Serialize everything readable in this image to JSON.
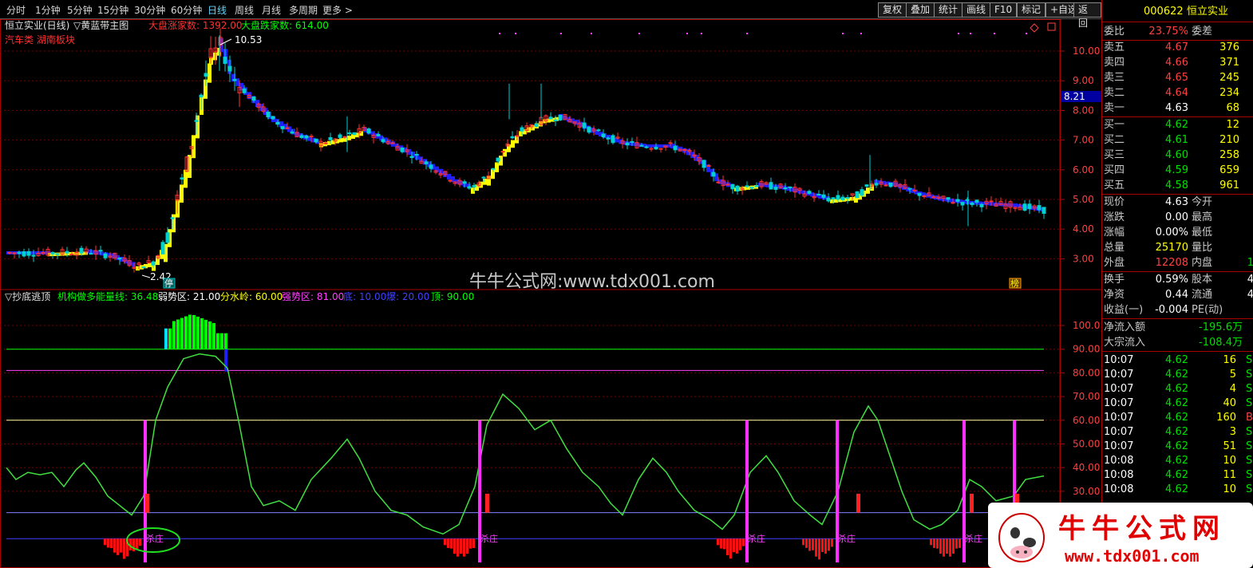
{
  "toolbar": {
    "periods": [
      "分时",
      "1分钟",
      "5分钟",
      "15分钟",
      "30分钟",
      "60分钟",
      "日线",
      "周线",
      "月线",
      "多周期",
      "更多 >"
    ],
    "active_period": "日线",
    "buttons": [
      "复权",
      "叠加",
      "统计",
      "画线",
      "F10",
      "标记",
      "+自选",
      "返回"
    ]
  },
  "main_chart": {
    "title": "恒立实业(日线)",
    "indicator": "▽黄蓝带主图",
    "up_count_label": "大盘涨家数: 1392.00",
    "down_count_label": "大盘跌家数: 614.00",
    "sector_tags": "汽车类 湖南板块",
    "high_label": "10.53",
    "low_label": "2.42",
    "current_price_tag": "8.21",
    "y_ticks": [
      "10.00",
      "9.00",
      "8.00",
      "7.00",
      "6.00",
      "5.00",
      "4.00",
      "3.00"
    ],
    "watermark": "牛牛公式网:www.tdx001.com",
    "mark_left": "停",
    "mark_right": "榜"
  },
  "sub_chart": {
    "title": "▽抄底逃顶",
    "legend": [
      {
        "text": "机构做多能量线: 36.48",
        "color": "#00ff00"
      },
      {
        "text": "弱势区: 21.00",
        "color": "#ffffff"
      },
      {
        "text": "分水岭: 60.00",
        "color": "#ffff00"
      },
      {
        "text": "强势区: 81.00",
        "color": "#ff40ff"
      },
      {
        "text": "底: 10.00",
        "color": "#4040ff"
      },
      {
        "text": "爆: 20.00",
        "color": "#4040ff"
      },
      {
        "text": "顶: 90.00",
        "color": "#00ff00"
      }
    ],
    "y_ticks": [
      "100.0",
      "90.00",
      "80.00",
      "70.00",
      "60.00",
      "50.00",
      "40.00",
      "30.00"
    ],
    "signal_label": "杀庄"
  },
  "quote": {
    "code": "000622",
    "name": "恒立实业",
    "weibi_label": "委比",
    "weibi_value": "23.75%",
    "weicha_label": "委差",
    "asks": [
      {
        "label": "卖五",
        "price": "4.67",
        "vol": "376"
      },
      {
        "label": "卖四",
        "price": "4.66",
        "vol": "371"
      },
      {
        "label": "卖三",
        "price": "4.65",
        "vol": "245"
      },
      {
        "label": "卖二",
        "price": "4.64",
        "vol": "234"
      },
      {
        "label": "卖一",
        "price": "4.63",
        "vol": "68"
      }
    ],
    "bids": [
      {
        "label": "买一",
        "price": "4.62",
        "vol": "12"
      },
      {
        "label": "买二",
        "price": "4.61",
        "vol": "210"
      },
      {
        "label": "买三",
        "price": "4.60",
        "vol": "258"
      },
      {
        "label": "买四",
        "price": "4.59",
        "vol": "659"
      },
      {
        "label": "买五",
        "price": "4.58",
        "vol": "961"
      }
    ],
    "stats": [
      {
        "l1": "现价",
        "v1": "4.63",
        "l2": "今开",
        "c": "wht"
      },
      {
        "l1": "涨跌",
        "v1": "0.00",
        "l2": "最高",
        "c": "wht"
      },
      {
        "l1": "涨幅",
        "v1": "0.00%",
        "l2": "最低",
        "c": "wht"
      },
      {
        "l1": "总量",
        "v1": "25170",
        "l2": "量比",
        "c": "yel"
      },
      {
        "l1": "外盘",
        "v1": "12208",
        "l2": "内盘",
        "c": "red",
        "v2": "1"
      }
    ],
    "stats2": [
      {
        "l1": "换手",
        "v1": "0.59%",
        "l2": "股本",
        "v2": "4"
      },
      {
        "l1": "净资",
        "v1": "0.44",
        "l2": "流通",
        "v2": "4"
      },
      {
        "l1": "收益(一)",
        "v1": "-0.004",
        "l2": "PE(动)",
        "v2": ""
      }
    ],
    "flows": [
      {
        "label": "净流入额",
        "value": "-195.6万"
      },
      {
        "label": "大宗流入",
        "value": "-108.4万"
      }
    ],
    "ticks": [
      {
        "t": "10:07",
        "p": "4.62",
        "v": "16",
        "s": "S"
      },
      {
        "t": "10:07",
        "p": "4.62",
        "v": "5",
        "s": "S"
      },
      {
        "t": "10:07",
        "p": "4.62",
        "v": "4",
        "s": "S"
      },
      {
        "t": "10:07",
        "p": "4.62",
        "v": "40",
        "s": "S"
      },
      {
        "t": "10:07",
        "p": "4.62",
        "v": "160",
        "s": "B"
      },
      {
        "t": "10:07",
        "p": "4.62",
        "v": "3",
        "s": "S"
      },
      {
        "t": "10:07",
        "p": "4.62",
        "v": "51",
        "s": "S"
      },
      {
        "t": "10:08",
        "p": "4.62",
        "v": "10",
        "s": "S"
      },
      {
        "t": "10:08",
        "p": "4.62",
        "v": "11",
        "s": "S"
      },
      {
        "t": "10:08",
        "p": "4.62",
        "v": "10",
        "s": "S"
      }
    ]
  },
  "stamp": {
    "title": "牛牛公式网",
    "url": "www.tdx001.com"
  },
  "colors": {
    "up": "#ff3030",
    "down": "#00d0d0",
    "yellow": "#ffff00",
    "blue": "#2020ff",
    "green_line": "#40e040",
    "magenta": "#ff30ff",
    "grid_red": "#aa0000"
  }
}
